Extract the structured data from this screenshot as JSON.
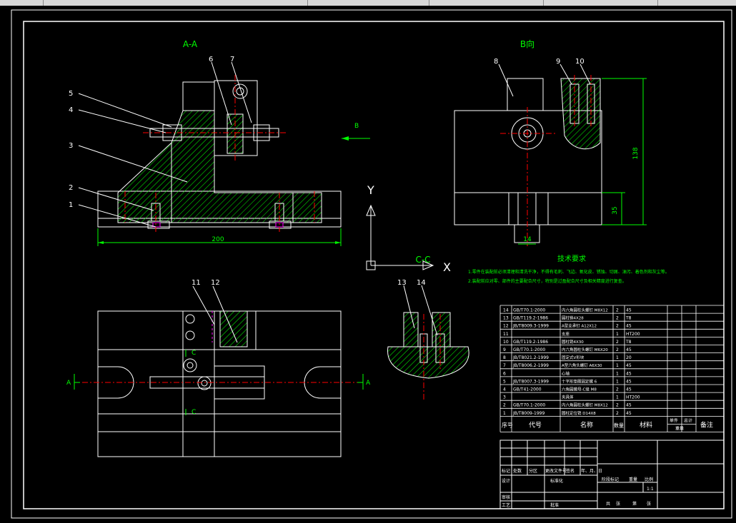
{
  "colors": {
    "background": "#000000",
    "line": "#ffffff",
    "title": "#00ff00",
    "label": "#ffffff",
    "dimension": "#00ff00",
    "centerline": "#ff0000",
    "hatch": "#00ff00",
    "table": "#ffffff"
  },
  "views": {
    "aa": "A-A",
    "b": "B向",
    "cc": "C-C",
    "b_arrow": "B",
    "a_left": "A",
    "a_right": "A",
    "c_top": "C",
    "c_bottom": "C"
  },
  "axes": {
    "y": "Y",
    "x": "X"
  },
  "callouts": {
    "n1": "1",
    "n2": "2",
    "n3": "3",
    "n4": "4",
    "n5": "5",
    "n6": "6",
    "n7": "7",
    "n8": "8",
    "n9": "9",
    "n10": "10",
    "n11": "11",
    "n12": "12",
    "n13": "13",
    "n14": "14"
  },
  "dimensions": {
    "length_200": "200",
    "height_138": "138",
    "height_35": "35",
    "width_14": "14"
  },
  "tech": {
    "title": "技术要求",
    "line1": "1.零件在装配前必须清理和清洗干净，不得有毛刺、飞边、氧化皮、锈蚀、切屑、油污、着色剂和灰尘等。",
    "line2": "2.装配前应对零、部件的主要配合尺寸，特别是过盈配合尺寸及相关精度进行复查。"
  },
  "bom": {
    "rows": [
      {
        "no": "14",
        "code": "GB/T70.1-2000",
        "name": "内六角圆柱头螺钉 M8X12",
        "qty": "2",
        "mat": "45"
      },
      {
        "no": "13",
        "code": "GB/T119.2-1986",
        "name": "圆柱销4X28",
        "qty": "2",
        "mat": "T8"
      },
      {
        "no": "12",
        "code": "JB/T8009.3-1999",
        "name": "A型支承钉 A12X12",
        "qty": "2",
        "mat": "45"
      },
      {
        "no": "11",
        "code": "",
        "name": "支座",
        "qty": "1",
        "mat": "HT200"
      },
      {
        "no": "10",
        "code": "GB/T119.2-1986",
        "name": "圆柱销4X30",
        "qty": "2",
        "mat": "T8"
      },
      {
        "no": "9",
        "code": "GB/T70.1-2000",
        "name": "内六角圆柱头螺钉 M6X20",
        "qty": "2",
        "mat": "45"
      },
      {
        "no": "8",
        "code": "JB/T8021.2-1999",
        "name": "固定式V形块",
        "qty": "1",
        "mat": "20"
      },
      {
        "no": "7",
        "code": "JB/T8006.2-1999",
        "name": "A型六角头螺钉 A6X30",
        "qty": "1",
        "mat": "45"
      },
      {
        "no": "6",
        "code": "",
        "name": "心轴",
        "qty": "1",
        "mat": "45"
      },
      {
        "no": "5",
        "code": "JB/T8007.3-1999",
        "name": "十字形垫圈固定螺 6",
        "qty": "1",
        "mat": "45"
      },
      {
        "no": "4",
        "code": "GB/T41-2000",
        "name": "六角圆螺母-C级 M8",
        "qty": "2",
        "mat": "45"
      },
      {
        "no": "3",
        "code": "",
        "name": "夹具体",
        "qty": "1",
        "mat": "HT200"
      },
      {
        "no": "2",
        "code": "GB/T70.1-2000",
        "name": "内六角圆柱头螺钉 M8X12",
        "qty": "2",
        "mat": "45"
      },
      {
        "no": "1",
        "code": "JB/T8009-1999",
        "name": "圆柱定位销 D14X8",
        "qty": "2",
        "mat": "45"
      }
    ],
    "header": {
      "no": "序号",
      "code": "代号",
      "name": "名称",
      "qty": "数量",
      "mat": "材料",
      "unit": "单件",
      "total": "总计",
      "weight": "重量",
      "remark": "备注"
    }
  },
  "titleblock": {
    "mark": "标记",
    "count": "处数",
    "zone": "分区",
    "docno": "更改文件号",
    "sign": "签名",
    "date": "年、月、日",
    "design": "设计",
    "standard": "标准化",
    "stage": "阶段标记",
    "weight": "重量",
    "scale": "比例",
    "scale_value": "1:1",
    "review": "审核",
    "process": "工艺",
    "approve": "批准",
    "sheets_total": "共",
    "sheets_no": "张",
    "sheet_of": "第",
    "sheet_unit": "张"
  }
}
